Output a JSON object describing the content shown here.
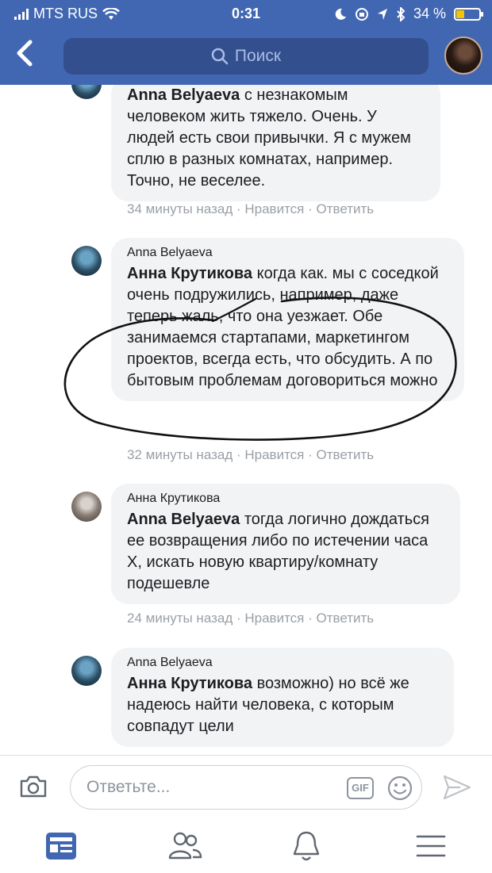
{
  "status_bar": {
    "carrier": "MTS RUS",
    "time": "0:31",
    "battery_text": "34 %",
    "battery_level": 0.34,
    "battery_color": "#f5c400"
  },
  "header": {
    "back_icon": "chevron-left-icon",
    "search_placeholder": "Поиск",
    "accent_color": "#4267b2"
  },
  "comments": [
    {
      "author": "",
      "mention": "Anna Belyaeva",
      "text": " с незнакомым человеком жить тяжело. Очень. У людей есть свои привычки. Я с мужем сплю в разных комнатах, например. Точно, не веселее.",
      "time": "34 минуты назад",
      "like": "Нравится",
      "reply": "Ответить"
    },
    {
      "author": "Anna Belyaeva",
      "mention": "Анна Крутикова",
      "text": " когда как. мы с соседкой очень подружились, например, даже теперь жаль, что она уезжает. Обе занимаемся стартапами, маркетингом проектов, всегда есть, что обсудить. А по бытовым проблемам договориться можно",
      "time": "32 минуты назад",
      "like": "Нравится",
      "reply": "Ответить"
    },
    {
      "author": "Анна Крутикова",
      "mention": "Anna Belyaeva",
      "text": " тогда логично дождаться ее возвращения либо по истечении часа Х, искать новую квартиру/комнату подешевле",
      "time": "24 минуты назад",
      "like": "Нравится",
      "reply": "Ответить"
    },
    {
      "author": "Anna Belyaeva",
      "mention": "Анна Крутикова",
      "text": " возможно) но всё же надеюсь найти человека, с которым совпадут цели",
      "time": "",
      "like": "",
      "reply": ""
    }
  ],
  "meta_separator": " · ",
  "reply_bar": {
    "placeholder": "Ответьте...",
    "gif_label": "GIF"
  },
  "tab_bar": {
    "items": [
      "news-feed-icon",
      "friends-icon",
      "notifications-bell-icon",
      "menu-icon"
    ],
    "active_color": "#4267b2"
  }
}
